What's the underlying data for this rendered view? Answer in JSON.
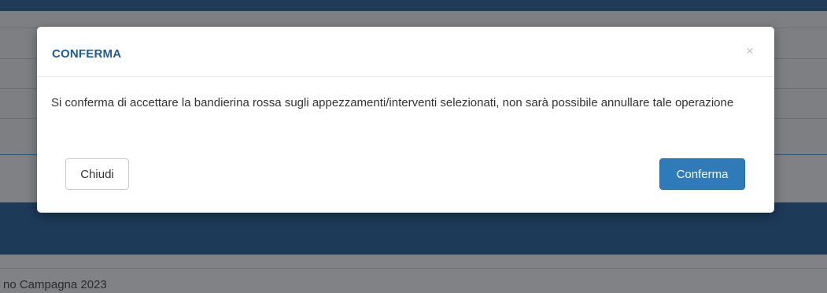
{
  "background": {
    "footer_text": "no Campagna 2023"
  },
  "modal": {
    "title": "CONFERMA",
    "close_symbol": "×",
    "message": "Si conferma di accettare la bandierina rossa sugli appezzamenti/interventi selezionati, non sarà possibile annullare tale operazione",
    "cancel_label": "Chiudi",
    "confirm_label": "Conferma"
  },
  "colors": {
    "title": "#1f5b96",
    "primary_button": "#2f7ab8",
    "header_bar": "#1d3a59"
  },
  "icons": {
    "close": "close-icon"
  }
}
